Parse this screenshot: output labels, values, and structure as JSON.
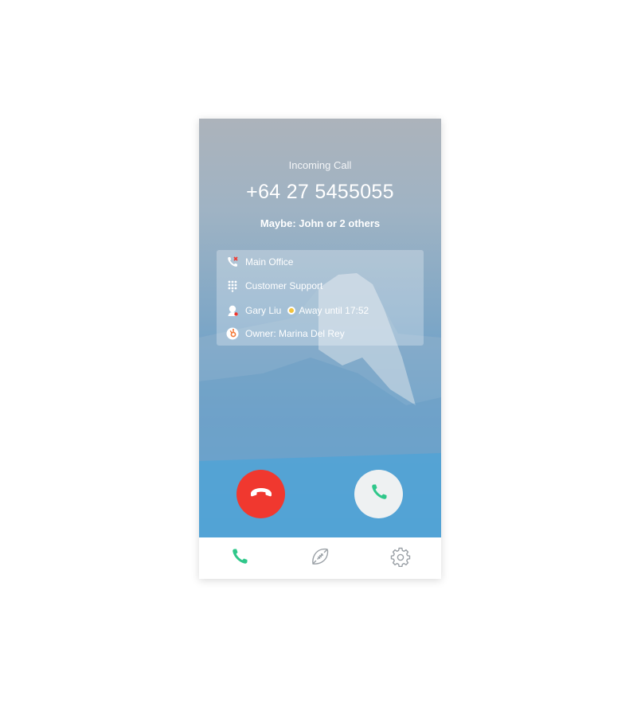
{
  "call": {
    "title": "Incoming Call",
    "number": "+64 27 5455055",
    "maybe": "Maybe: John or 2 others"
  },
  "info": {
    "line": {
      "label": "Main Office",
      "icon": "phone-line-icon"
    },
    "queue": {
      "label": "Customer Support",
      "icon": "keypad-icon"
    },
    "agent": {
      "name": "Gary Liu",
      "status": "Away until 17:52",
      "icon": "person-icon",
      "status_color": "#f2c33c"
    },
    "owner": {
      "label": "Owner: Marina Del Rey",
      "icon": "hubspot-icon"
    }
  },
  "actions": {
    "decline": {
      "icon": "hang-up-icon",
      "color": "#f0382f"
    },
    "accept": {
      "icon": "phone-icon",
      "color": "#2fc78a"
    }
  },
  "tabs": [
    {
      "name": "calls",
      "icon": "phone-icon",
      "active": true,
      "color": "#2fc78a"
    },
    {
      "name": "sports",
      "icon": "football-icon",
      "active": false,
      "color": "#9aa0a6"
    },
    {
      "name": "settings",
      "icon": "gear-icon",
      "active": false,
      "color": "#9aa0a6"
    }
  ]
}
